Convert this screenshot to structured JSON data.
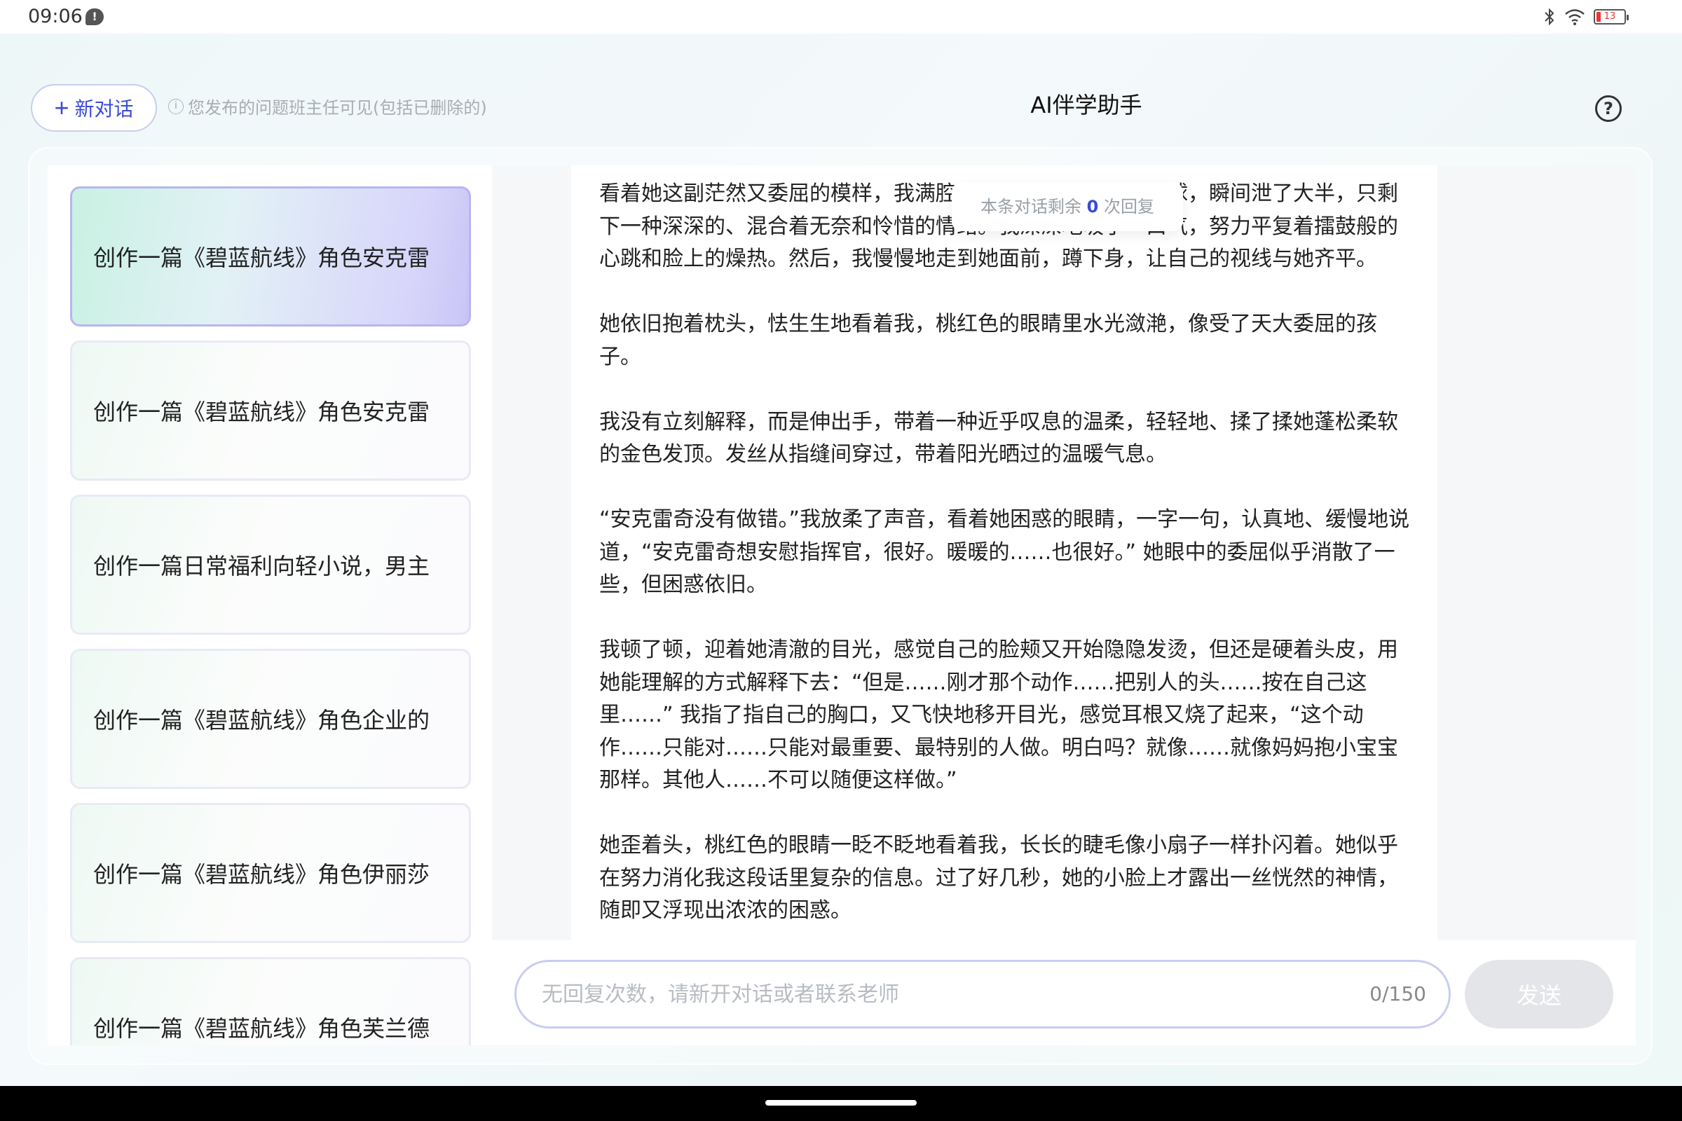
{
  "status_bar": {
    "time": "09:06",
    "notification_badge": "!",
    "battery_level": "13",
    "icons": [
      "bluetooth-icon",
      "wifi-icon",
      "battery-icon"
    ]
  },
  "header": {
    "new_chat_plus": "+",
    "new_chat_label": "新对话",
    "notice_icon": "i",
    "notice_text": "您发布的问题班主任可见(包括已删除的)",
    "title": "AI伴学助手",
    "help_icon": "?"
  },
  "sidebar": {
    "items": [
      {
        "label": "创作一篇《碧蓝航线》角色安克雷",
        "active": true
      },
      {
        "label": "创作一篇《碧蓝航线》角色安克雷",
        "active": false
      },
      {
        "label": "创作一篇日常福利向轻小说，男主",
        "active": false
      },
      {
        "label": "创作一篇《碧蓝航线》角色企业的",
        "active": false
      },
      {
        "label": "创作一篇《碧蓝航线》角色伊丽莎",
        "active": false
      },
      {
        "label": "创作一篇《碧蓝航线》角色芙兰德",
        "active": false
      }
    ]
  },
  "chat": {
    "remaining_prefix": "本条对话剩余",
    "remaining_count": "0",
    "remaining_suffix": "次回复",
    "paragraphs": [
      "看着她这副茫然又委屈的模样，我满腔的羞恼就像被戳破的气球，瞬间泄了大半，只剩下一种深深的、混合着无奈和怜惜的情绪。我深深地吸了一口气，努力平复着擂鼓般的心跳和脸上的燥热。然后，我慢慢地走到她面前，蹲下身，让自己的视线与她齐平。",
      "她依旧抱着枕头，怯生生地看着我，桃红色的眼睛里水光潋滟，像受了天大委屈的孩子。",
      "我没有立刻解释，而是伸出手，带着一种近乎叹息的温柔，轻轻地、揉了揉她蓬松柔软的金色发顶。发丝从指缝间穿过，带着阳光晒过的温暖气息。",
      "“安克雷奇没有做错。”我放柔了声音，看着她困惑的眼睛，一字一句，认真地、缓慢地说道，“安克雷奇想安慰指挥官，很好。暖暖的……也很好。” 她眼中的委屈似乎消散了一些，但困惑依旧。",
      "我顿了顿，迎着她清澈的目光，感觉自己的脸颊又开始隐隐发烫，但还是硬着头皮，用她能理解的方式解释下去：“但是……刚才那个动作……把别人的头……按在自己这里……” 我指了指自己的胸口，又飞快地移开目光，感觉耳根又烧了起来，“这个动作……只能对……只能对最重要、最特别的人做。明白吗？就像……就像妈妈抱小宝宝那样。其他人……不可以随便这样做。”",
      "她歪着头，桃红色的眼睛一眨不眨地看着我，长长的睫毛像小扇子一样扑闪着。她似乎在努力消化我这段话里复杂的信息。过了好几秒，她的小脸上才露出一丝恍然的神情，随即又浮现出浓浓的困惑。"
    ]
  },
  "composer": {
    "placeholder": "无回复次数，请新开对话或者联系老师",
    "value": "",
    "char_count": "0/150",
    "send_label": "发送"
  }
}
